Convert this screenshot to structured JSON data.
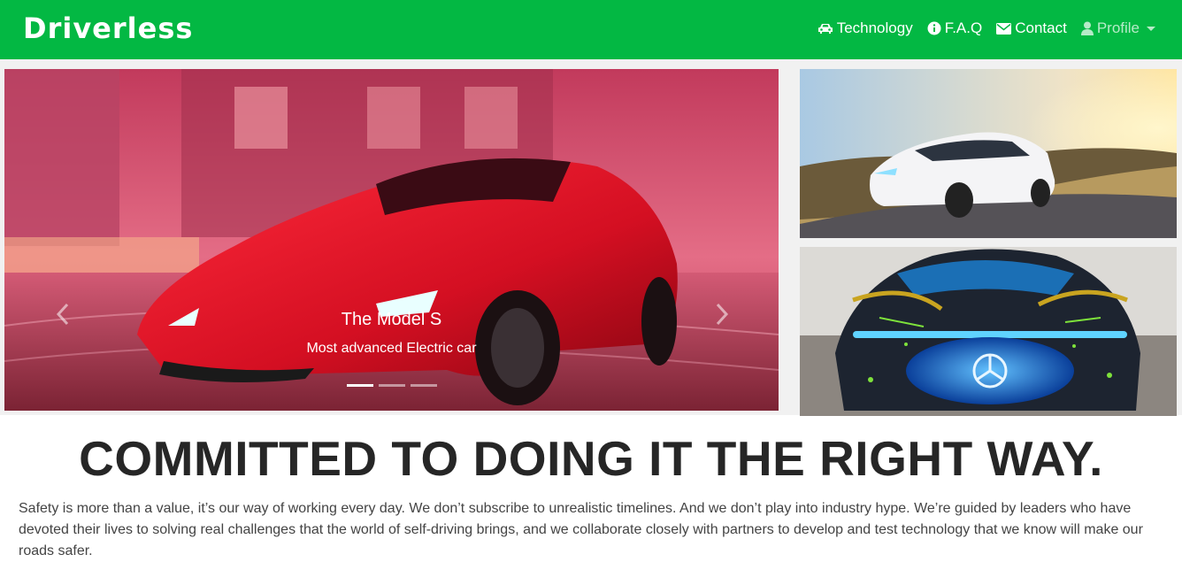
{
  "brand": "Driverless",
  "nav": {
    "technology": "Technology",
    "faq": "F.A.Q",
    "contact": "Contact",
    "profile": "Profile"
  },
  "carousel": {
    "caption_title": "The Model S",
    "caption_subtitle": "Most advanced Electric car",
    "slide_count": 3,
    "active_index": 0
  },
  "colors": {
    "navbar": "#03b843",
    "headline": "#262626",
    "body_text": "#444444"
  },
  "icons": [
    "car-icon",
    "info-icon",
    "envelope-icon",
    "user-icon",
    "chevron-left-icon",
    "chevron-right-icon",
    "caret-down-icon"
  ],
  "main": {
    "headline": "COMMITTED TO DOING IT THE RIGHT WAY.",
    "paragraph": "Safety is more than a value, it’s our way of working every day. We don’t subscribe to unrealistic timelines. And we don’t play into industry hype. We’re guided by leaders who have devoted their lives to solving real challenges that the world of self-driving brings, and we collaborate closely with partners to develop and test technology that we know will make our roads safer."
  }
}
